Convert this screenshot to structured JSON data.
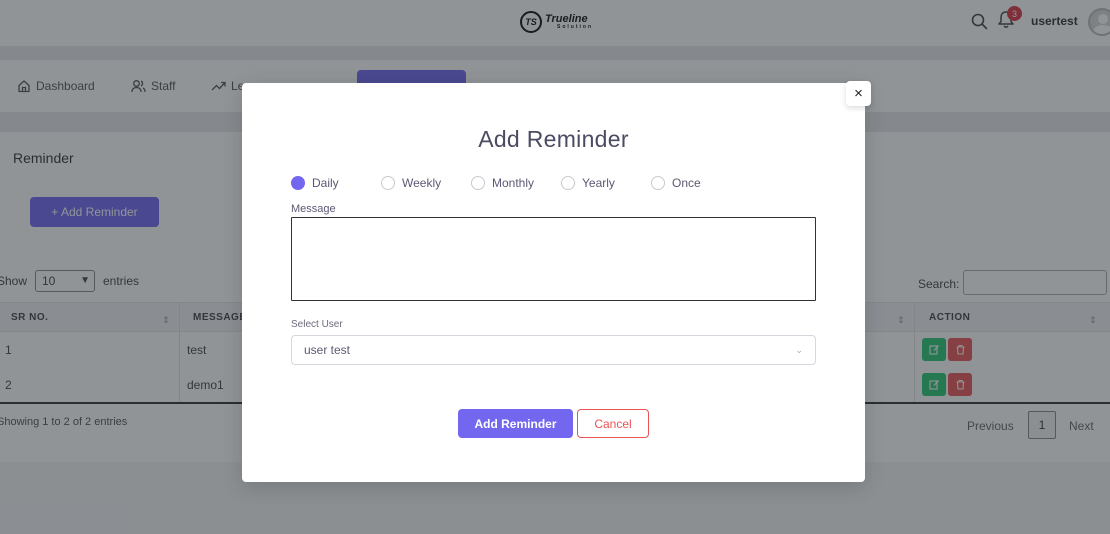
{
  "header": {
    "logo_name": "Trueline",
    "logo_sub": "Solution",
    "logo_mark": "TS",
    "notification_count": "3",
    "username": "usertest",
    "icons": [
      "search-icon",
      "bell-icon",
      "avatar"
    ]
  },
  "nav": {
    "items": [
      {
        "label": "Dashboard",
        "icon": "home-icon"
      },
      {
        "label": "Staff",
        "icon": "users-icon"
      },
      {
        "label": "Le",
        "icon": "trending-up-icon"
      }
    ],
    "active_color": "#7367f0"
  },
  "page": {
    "title": "Reminder",
    "add_button": "+ Add Reminder",
    "show_label": "Show",
    "entries_value": "10",
    "entries_label": "entries",
    "search_label": "Search:",
    "columns": [
      "SR NO.",
      "MESSAGE",
      "ACTION"
    ],
    "rows": [
      {
        "sr": "1",
        "message": "test"
      },
      {
        "sr": "2",
        "message": "demo1"
      }
    ],
    "showing_text": "Showing 1 to 2 of 2 entries",
    "pagination": {
      "previous": "Previous",
      "page": "1",
      "next": "Next"
    }
  },
  "modal": {
    "title": "Add Reminder",
    "close_symbol": "×",
    "frequency_options": [
      "Daily",
      "Weekly",
      "Monthly",
      "Yearly",
      "Once"
    ],
    "selected_frequency": "Daily",
    "message_label": "Message",
    "message_value": "",
    "select_user_label": "Select User",
    "select_user_value": "user test",
    "submit_label": "Add Reminder",
    "cancel_label": "Cancel"
  },
  "colors": {
    "primary": "#7367f0",
    "danger": "#ea5455",
    "success": "#28c76f",
    "badge": "#dc3545"
  }
}
